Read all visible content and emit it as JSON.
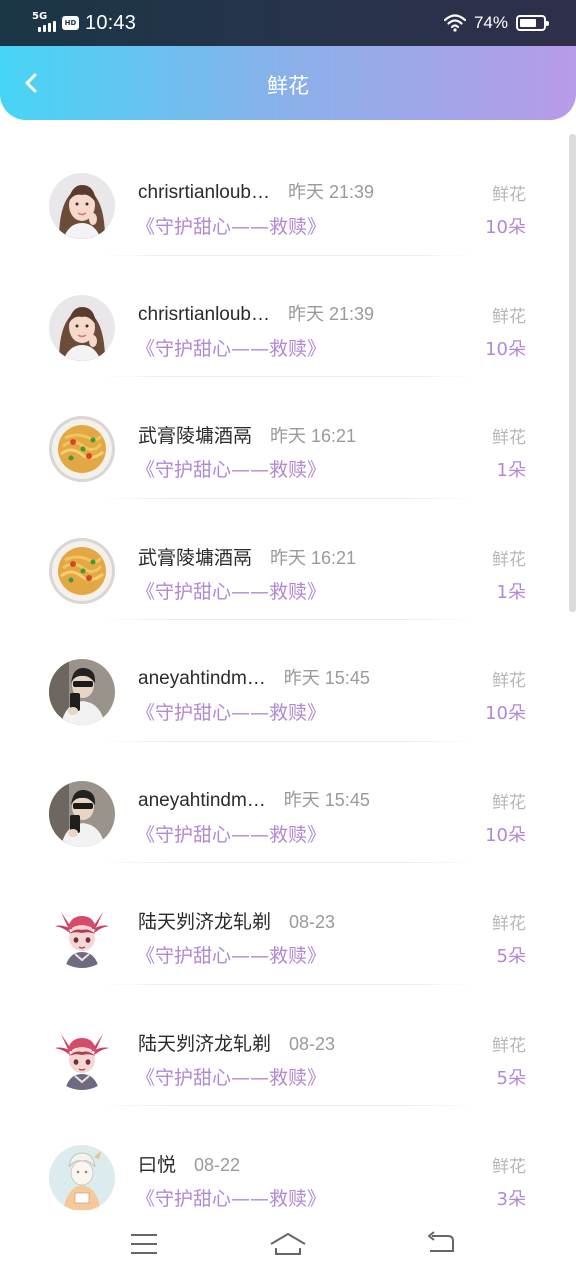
{
  "status_bar": {
    "network": "5G",
    "hd_label": "HD",
    "time": "10:43",
    "battery_text": "74%",
    "battery_level": 0.74
  },
  "header": {
    "title": "鲜花",
    "back_icon": "chevron-left-icon"
  },
  "colors": {
    "accent_purple": "#b288d6",
    "header_gradient_start": "#46d5f6",
    "header_gradient_end": "#b79be9"
  },
  "records": [
    {
      "name": "chrisrtianloub…",
      "time": "昨天 21:39",
      "gift": "《守护甜心——救赎》",
      "kind": "鲜花",
      "count": "10朵",
      "avatar": "girl-portrait"
    },
    {
      "name": "chrisrtianloub…",
      "time": "昨天 21:39",
      "gift": "《守护甜心——救赎》",
      "kind": "鲜花",
      "count": "10朵",
      "avatar": "girl-portrait"
    },
    {
      "name": "武膏陵墉酒鬲",
      "time": "昨天 16:21",
      "gift": "《守护甜心——救赎》",
      "kind": "鲜花",
      "count": "1朵",
      "avatar": "noodle-dish"
    },
    {
      "name": "武膏陵墉酒鬲",
      "time": "昨天 16:21",
      "gift": "《守护甜心——救赎》",
      "kind": "鲜花",
      "count": "1朵",
      "avatar": "noodle-dish"
    },
    {
      "name": "aneyahtindm…",
      "time": "昨天 15:45",
      "gift": "《守护甜心——救赎》",
      "kind": "鲜花",
      "count": "10朵",
      "avatar": "boy-selfie"
    },
    {
      "name": "aneyahtindm…",
      "time": "昨天 15:45",
      "gift": "《守护甜心——救赎》",
      "kind": "鲜花",
      "count": "10朵",
      "avatar": "boy-selfie"
    },
    {
      "name": "陆天刿济龙轧剃",
      "time": "08-23",
      "gift": "《守护甜心——救赎》",
      "kind": "鲜花",
      "count": "5朵",
      "avatar": "anime-character"
    },
    {
      "name": "陆天刿济龙轧剃",
      "time": "08-23",
      "gift": "《守护甜心——救赎》",
      "kind": "鲜花",
      "count": "5朵",
      "avatar": "anime-character"
    },
    {
      "name": "曰悦",
      "time": "08-22",
      "gift": "《守护甜心——救赎》",
      "kind": "鲜花",
      "count": "3朵",
      "avatar": "sketch-character"
    }
  ],
  "nav_bar": {
    "menu_icon": "menu-icon",
    "home_icon": "home-icon",
    "back_icon": "back-arrow-icon"
  }
}
